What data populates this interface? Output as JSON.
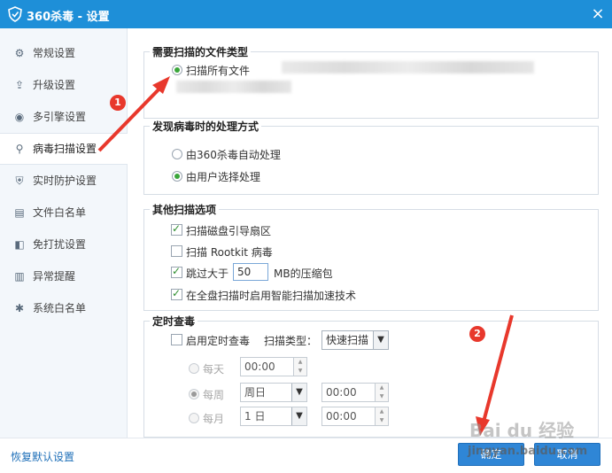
{
  "window": {
    "title": "360杀毒 - 设置",
    "close_label": "×"
  },
  "sidebar": {
    "items": [
      {
        "label": "常规设置",
        "icon": "gear-icon",
        "glyph": "⚙"
      },
      {
        "label": "升级设置",
        "icon": "upload-icon",
        "glyph": "⇪"
      },
      {
        "label": "多引擎设置",
        "icon": "engine-icon",
        "glyph": "◉"
      },
      {
        "label": "病毒扫描设置",
        "icon": "search-icon",
        "glyph": "⚲",
        "active": true
      },
      {
        "label": "实时防护设置",
        "icon": "shield-icon",
        "glyph": "⛨"
      },
      {
        "label": "文件白名单",
        "icon": "file-icon",
        "glyph": "▤"
      },
      {
        "label": "免打扰设置",
        "icon": "no-disturb-icon",
        "glyph": "◧"
      },
      {
        "label": "异常提醒",
        "icon": "bar-chart-icon",
        "glyph": "▥"
      },
      {
        "label": "系统白名单",
        "icon": "tools-icon",
        "glyph": "✱"
      }
    ]
  },
  "file_types": {
    "title": "需要扫描的文件类型",
    "scan_all": "扫描所有文件"
  },
  "virus_handling": {
    "title": "发现病毒时的处理方式",
    "auto": "由360杀毒自动处理",
    "user": "由用户选择处理"
  },
  "other_options": {
    "title": "其他扫描选项",
    "boot_sector": "扫描磁盘引导扇区",
    "rootkit": "扫描 Rootkit 病毒",
    "skip_prefix": "跳过大于",
    "skip_value": "50",
    "skip_suffix": "MB的压缩包",
    "smart_scan": "在全盘扫描时启用智能扫描加速技术"
  },
  "scheduled": {
    "title": "定时查毒",
    "enable": "启用定时查毒",
    "scan_type_label": "扫描类型：",
    "scan_type_value": "快速扫描",
    "daily": "每天",
    "daily_time": "00:00",
    "weekly": "每周",
    "weekly_day": "周日",
    "weekly_time": "00:00",
    "monthly": "每月",
    "monthly_day": "1 日",
    "monthly_time": "00:00"
  },
  "footer": {
    "restore": "恢复默认设置",
    "ok": "确定",
    "cancel": "取消"
  },
  "annotations": {
    "badge1": "1",
    "badge2": "2",
    "watermark": "Bai du 经验",
    "watermark_url": "jingyan.baidu.com"
  },
  "colors": {
    "titlebar": "#1e8fd8",
    "accent_green": "#3aa63a",
    "button_blue": "#2f86d6",
    "badge_red": "#e8382c"
  }
}
